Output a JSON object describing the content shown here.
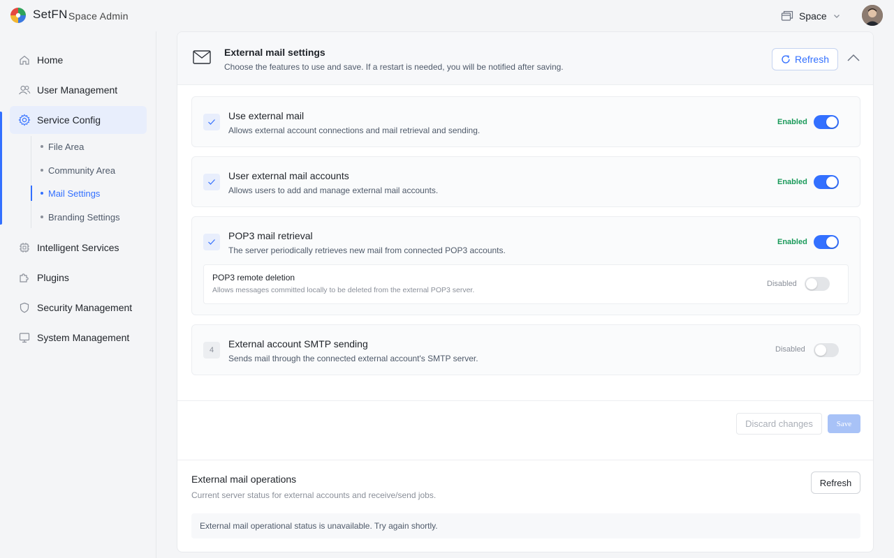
{
  "header": {
    "brand": "SetFN",
    "subtitle": "Space Admin",
    "space_label": "Space"
  },
  "sidebar": {
    "items": [
      {
        "label": "Home",
        "icon": "home-icon"
      },
      {
        "label": "User Management",
        "icon": "users-icon"
      },
      {
        "label": "Service Config",
        "icon": "gear-icon",
        "active": true
      },
      {
        "label": "Intelligent Services",
        "icon": "chip-icon"
      },
      {
        "label": "Plugins",
        "icon": "puzzle-icon"
      },
      {
        "label": "Security Management",
        "icon": "shield-icon"
      },
      {
        "label": "System Management",
        "icon": "monitor-icon"
      }
    ],
    "sub_items": [
      {
        "label": "File Area"
      },
      {
        "label": "Community Area"
      },
      {
        "label": "Mail Settings",
        "active": true
      },
      {
        "label": "Branding Settings"
      }
    ]
  },
  "settings": {
    "title": "External mail settings",
    "description": "Choose the features to use and save. If a restart is needed, you will be notified after saving.",
    "refresh_label": "Refresh",
    "features": [
      {
        "title": "Use external mail",
        "description": "Allows external account connections and mail retrieval and sending.",
        "status": "Enabled",
        "enabled": true
      },
      {
        "title": "User external mail accounts",
        "description": "Allows users to add and manage external mail accounts.",
        "status": "Enabled",
        "enabled": true
      },
      {
        "title": "POP3 mail retrieval",
        "description": "The server periodically retrieves new mail from connected POP3 accounts.",
        "status": "Enabled",
        "enabled": true,
        "sub": {
          "title": "POP3 remote deletion",
          "description": "Allows messages committed locally to be deleted from the external POP3 server.",
          "status": "Disabled",
          "enabled": false
        }
      },
      {
        "number": "4",
        "title": "External account SMTP sending",
        "description": "Sends mail through the connected external account's SMTP server.",
        "status": "Disabled",
        "enabled": false
      }
    ],
    "discard_label": "Discard changes",
    "save_label": "Save"
  },
  "operations": {
    "title": "External mail operations",
    "description": "Current server status for external accounts and receive/send jobs.",
    "refresh_label": "Refresh",
    "status_message": "External mail operational status is unavailable. Try again shortly."
  },
  "colors": {
    "accent": "#3370ff",
    "enabled_text": "#1a9a5a",
    "active_bg": "#e8eefc"
  }
}
